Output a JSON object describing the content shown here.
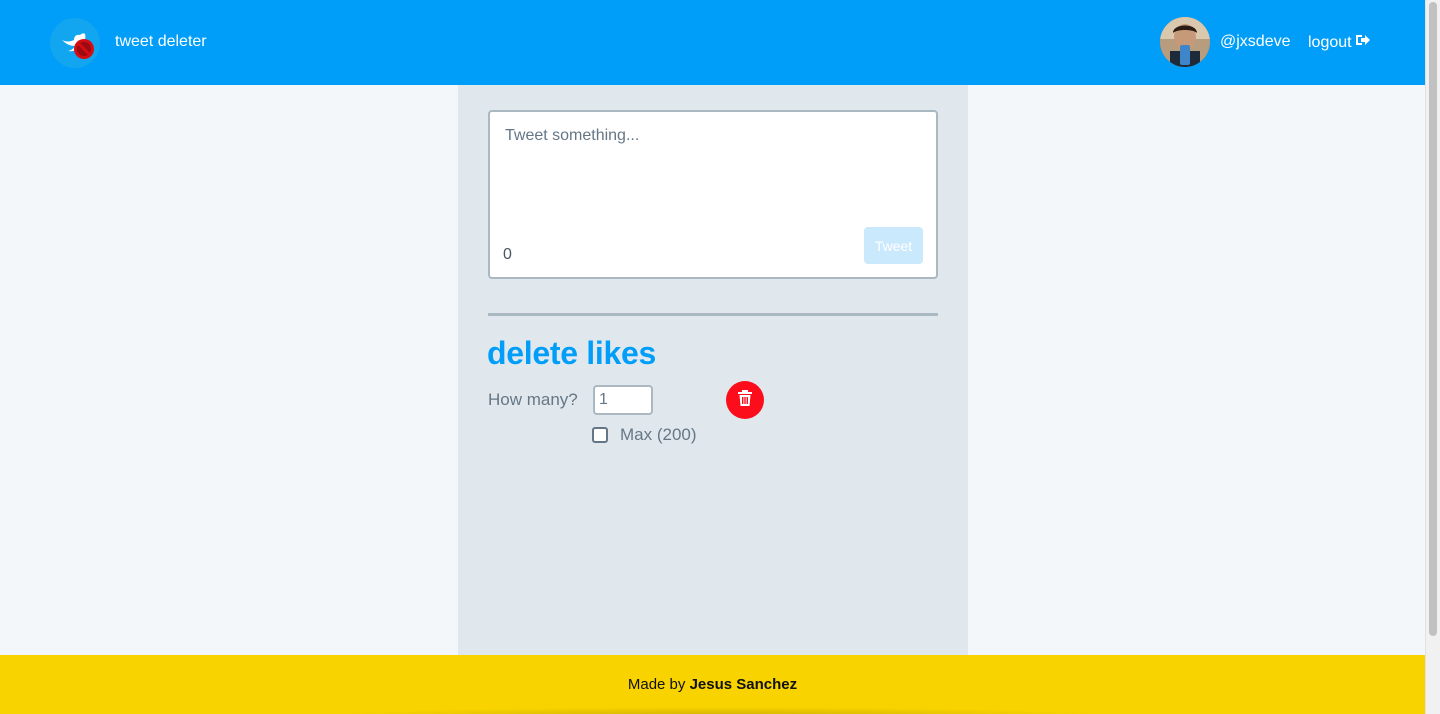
{
  "header": {
    "app_title": "tweet deleter",
    "username": "@jxsdeve",
    "logout_label": "logout"
  },
  "composer": {
    "placeholder": "Tweet something...",
    "char_count": "0",
    "tweet_button": "Tweet"
  },
  "delete_likes": {
    "title": "delete likes",
    "how_many_label": "How many?",
    "how_many_value": "1",
    "max_label": "Max (200)",
    "max_checked": false
  },
  "footer": {
    "prefix": "Made by ",
    "author": "Jesus Sanchez"
  },
  "colors": {
    "header_bg": "#009ef9",
    "accent_blue": "#009ef9",
    "footer_bg": "#f8d300",
    "delete_red": "#fc0d1b",
    "column_bg": "#e1e8ed",
    "page_bg": "#f3f7fa"
  },
  "icons": {
    "logo": "bird-with-no-sign-icon",
    "logout": "sign-out-icon",
    "delete": "trash-icon"
  }
}
